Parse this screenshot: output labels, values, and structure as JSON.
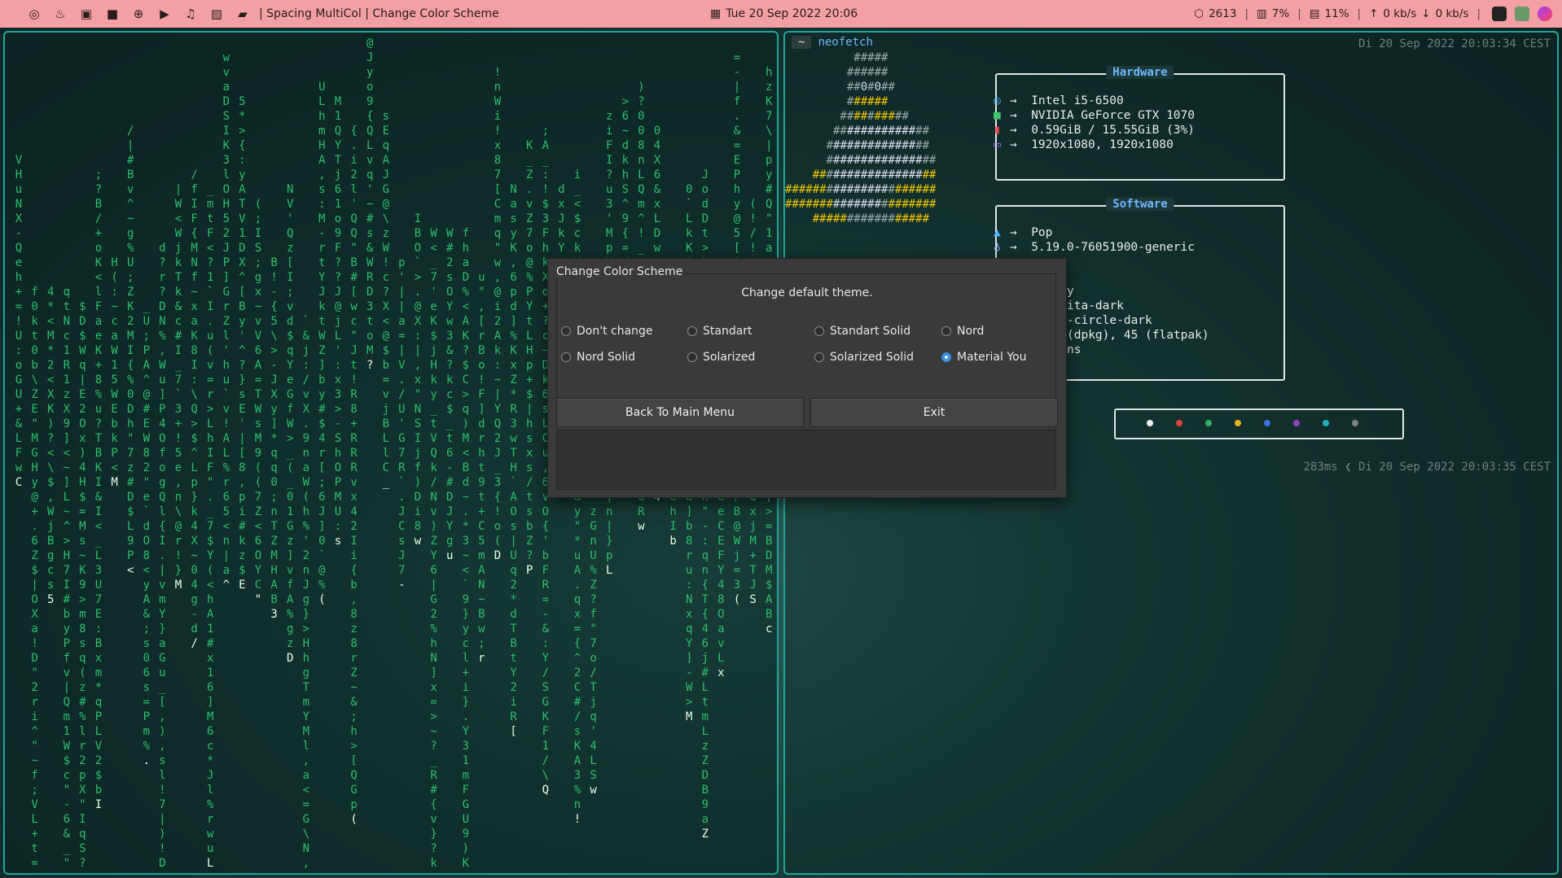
{
  "topbar": {
    "icons": [
      "browser-icon",
      "flame-icon",
      "discord-icon",
      "video-icon",
      "gamepad-icon",
      "youtube-icon",
      "music-icon",
      "image-icon",
      "folder-icon"
    ],
    "window_title": "| Spacing MultiCol | Change Color Scheme",
    "datetime": "Tue 20 Sep 2022 20:06",
    "stats": {
      "processes": "2613",
      "cpu": "7%",
      "disk": "11%",
      "net_up": "0 kb/s",
      "net_down": "0 kb/s"
    }
  },
  "terminal": {
    "prompt": "~",
    "command": "neofetch",
    "timestamp_top": "Di 20 Sep 2022 20:03:34 CEST",
    "timestamp_bottom": "283ms ❮ Di 20 Sep 2022 20:03:35 CEST",
    "hardware_title": "Hardware",
    "hardware": [
      {
        "icon": "cpu-icon",
        "color": "#4fb3ff",
        "value": "Intel i5-6500"
      },
      {
        "icon": "gpu-icon",
        "color": "#3ec46d",
        "value": "NVIDIA GeForce GTX 1070"
      },
      {
        "icon": "memory-icon",
        "color": "#ff4a4a",
        "value": "0.59GiB / 15.55GiB (3%)"
      },
      {
        "icon": "display-icon",
        "color": "#a070ff",
        "value": "1920x1080, 1920x1080"
      }
    ],
    "software_title": "Software",
    "software": [
      {
        "icon": "os-icon",
        "color": "#4fb3ff",
        "value": "Pop"
      },
      {
        "icon": "kernel-icon",
        "color": "#a0b0ff",
        "value": "5.19.0-76051900-generic"
      }
    ],
    "software_partial": [
      "y",
      "ita-dark",
      "-circle-dark",
      "(dpkg), 45 (flatpak)",
      "ns"
    ],
    "palette": [
      "#f0f0f0",
      "#e04040",
      "#30b060",
      "#e8b020",
      "#4070e0",
      "#9040c0",
      "#20b0c0",
      "#808080"
    ]
  },
  "dialog": {
    "title": "Change Color Scheme",
    "message": "Change default theme.",
    "options": [
      {
        "label": "Don't change",
        "checked": false
      },
      {
        "label": "Standart",
        "checked": false
      },
      {
        "label": "Standart Solid",
        "checked": false
      },
      {
        "label": "Nord",
        "checked": false
      },
      {
        "label": "Nord Solid",
        "checked": false
      },
      {
        "label": "Solarized",
        "checked": false
      },
      {
        "label": "Solarized Solid",
        "checked": false
      },
      {
        "label": "Material You",
        "checked": true
      }
    ],
    "back_label": "Back To Main Menu",
    "exit_label": "Exit"
  }
}
